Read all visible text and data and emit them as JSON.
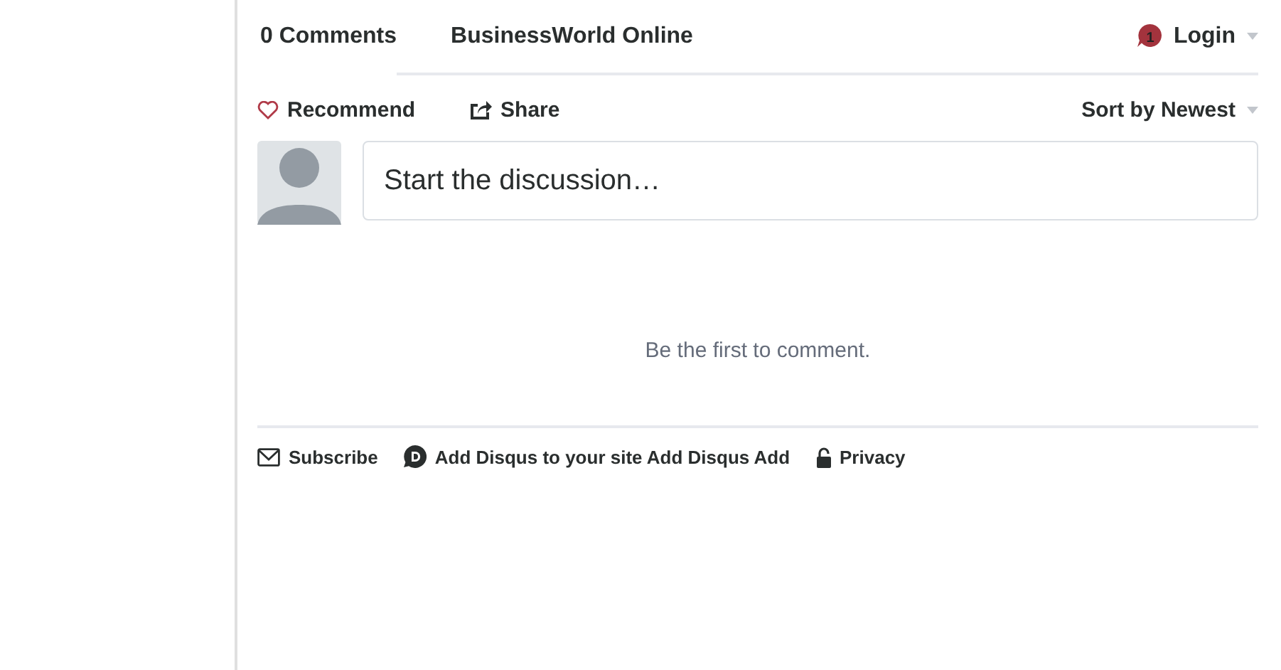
{
  "tabs": [
    {
      "label": "0 Comments",
      "selected": true
    },
    {
      "label": "BusinessWorld Online",
      "selected": false
    }
  ],
  "login": {
    "badge": "1",
    "label": "Login"
  },
  "actions": {
    "recommend": "Recommend",
    "share": "Share",
    "sort": "Sort by Newest"
  },
  "composer": {
    "placeholder": "Start the discussion…"
  },
  "empty_message": "Be the first to comment.",
  "footer": {
    "subscribe": "Subscribe",
    "add_disqus": "Add Disqus to your site Add Disqus Add",
    "privacy": "Privacy"
  }
}
